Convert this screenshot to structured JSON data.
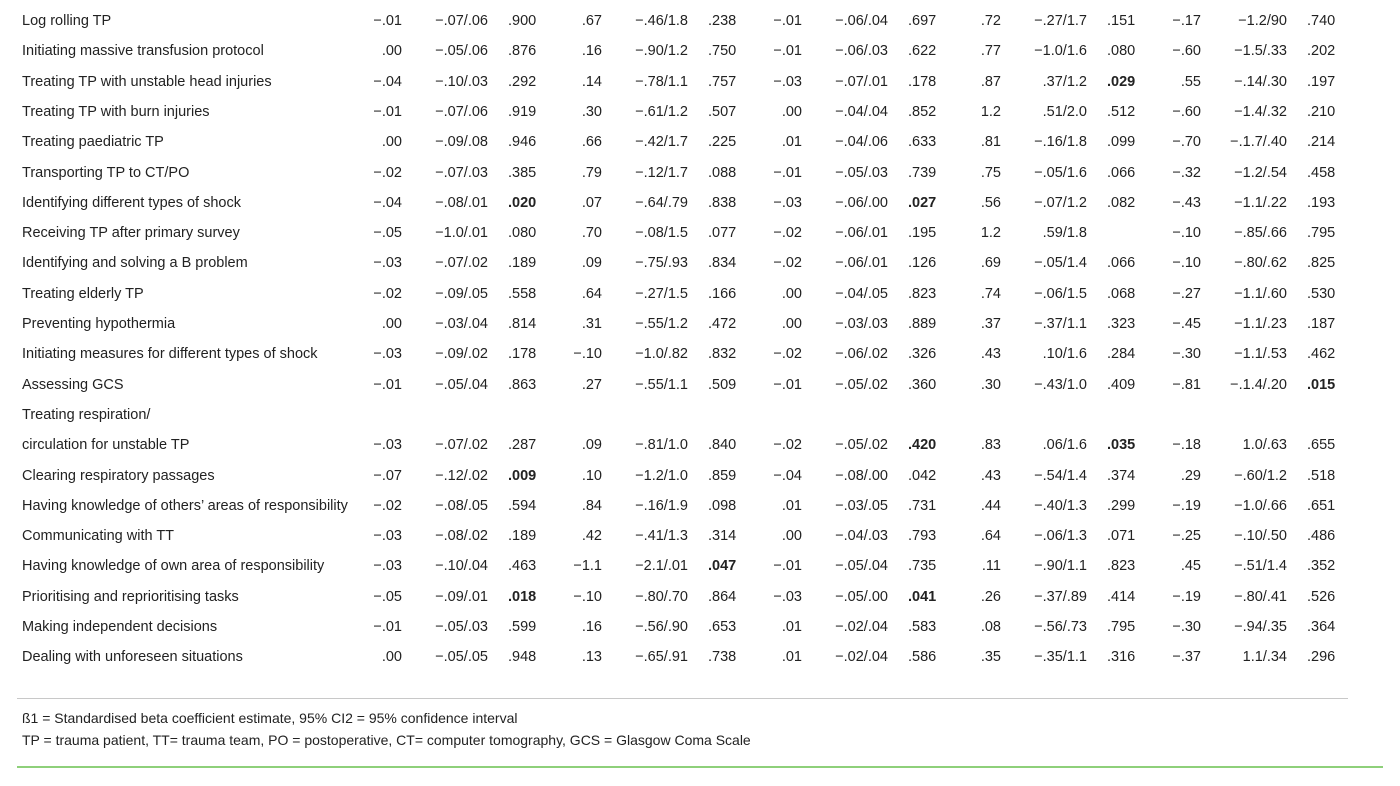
{
  "table": {
    "rows": [
      {
        "label": "Log rolling TP",
        "cells": [
          "−.01",
          "−.07/.06",
          ".900",
          ".67",
          "−.46/1.8",
          ".238",
          "−.01",
          "−.06/.04",
          ".697",
          ".72",
          "−.27/1.7",
          ".151",
          "−.17",
          "−1.2/90",
          ".740"
        ],
        "bold": []
      },
      {
        "label": "Initiating massive transfusion protocol",
        "cells": [
          ".00",
          "−.05/.06",
          ".876",
          ".16",
          "−.90/1.2",
          ".750",
          "−.01",
          "−.06/.03",
          ".622",
          ".77",
          "−1.0/1.6",
          ".080",
          "−.60",
          "−1.5/.33",
          ".202"
        ],
        "bold": []
      },
      {
        "label": "Treating TP with unstable head injuries",
        "cells": [
          "−.04",
          "−.10/.03",
          ".292",
          ".14",
          "−.78/1.1",
          ".757",
          "−.03",
          "−.07/.01",
          ".178",
          ".87",
          ".37/1.2",
          ".029",
          ".55",
          "−.14/.30",
          ".197"
        ],
        "bold": [
          11
        ]
      },
      {
        "label": "Treating TP with burn injuries",
        "cells": [
          "−.01",
          "−.07/.06",
          ".919",
          ".30",
          "−.61/1.2",
          ".507",
          ".00",
          "−.04/.04",
          ".852",
          "1.2",
          ".51/2.0",
          ".512",
          "−.60",
          "−1.4/.32",
          ".210"
        ],
        "bold": []
      },
      {
        "label": "Treating paediatric TP",
        "cells": [
          ".00",
          "−.09/.08",
          ".946",
          ".66",
          "−.42/1.7",
          ".225",
          ".01",
          "−.04/.06",
          ".633",
          ".81",
          "−.16/1.8",
          ".099",
          "−.70",
          "−.1.7/.40",
          ".214"
        ],
        "bold": []
      },
      {
        "label": "Transporting TP to CT/PO",
        "cells": [
          "−.02",
          "−.07/.03",
          ".385",
          ".79",
          "−.12/1.7",
          ".088",
          "−.01",
          "−.05/.03",
          ".739",
          ".75",
          "−.05/1.6",
          ".066",
          "−.32",
          "−1.2/.54",
          ".458"
        ],
        "bold": []
      },
      {
        "label": "Identifying different types of shock",
        "cells": [
          "−.04",
          "−.08/.01",
          ".020",
          ".07",
          "−.64/.79",
          ".838",
          "−.03",
          "−.06/.00",
          ".027",
          ".56",
          "−.07/1.2",
          ".082",
          "−.43",
          "−1.1/.22",
          ".193"
        ],
        "bold": [
          2,
          8
        ]
      },
      {
        "label": "Receiving TP after primary survey",
        "cells": [
          "−.05",
          "−1.0/.01",
          ".080",
          ".70",
          "−.08/1.5",
          ".077",
          "−.02",
          "−.06/.01",
          ".195",
          "1.2",
          ".59/1.8",
          "",
          "−.10",
          "−.85/.66",
          ".795"
        ],
        "bold": []
      },
      {
        "label": "Identifying and solving a B problem",
        "cells": [
          "−.03",
          "−.07/.02",
          ".189",
          ".09",
          "−.75/.93",
          ".834",
          "−.02",
          "−.06/.01",
          ".126",
          ".69",
          "−.05/1.4",
          ".066",
          "−.10",
          "−.80/.62",
          ".825"
        ],
        "bold": []
      },
      {
        "label": "Treating elderly TP",
        "cells": [
          "−.02",
          "−.09/.05",
          ".558",
          ".64",
          "−.27/1.5",
          ".166",
          ".00",
          "−.04/.05",
          ".823",
          ".74",
          "−.06/1.5",
          ".068",
          "−.27",
          "−1.1/.60",
          ".530"
        ],
        "bold": []
      },
      {
        "label": "Preventing hypothermia",
        "cells": [
          ".00",
          "−.03/.04",
          ".814",
          ".31",
          "−.55/1.2",
          ".472",
          ".00",
          "−.03/.03",
          ".889",
          ".37",
          "−.37/1.1",
          ".323",
          "−.45",
          "−1.1/.23",
          ".187"
        ],
        "bold": []
      },
      {
        "label": "Initiating measures for different types of shock",
        "cells": [
          "−.03",
          "−.09/.02",
          ".178",
          "−.10",
          "−1.0/.82",
          ".832",
          "−.02",
          "−.06/.02",
          ".326",
          ".43",
          ".10/1.6",
          ".284",
          "−.30",
          "−1.1/.53",
          ".462"
        ],
        "bold": []
      },
      {
        "label": "Assessing GCS",
        "cells": [
          "−.01",
          "−.05/.04",
          ".863",
          ".27",
          "−.55/1.1",
          ".509",
          "−.01",
          "−.05/.02",
          ".360",
          ".30",
          "−.43/1.0",
          ".409",
          "−.81",
          "−.1.4/.20",
          ".015"
        ],
        "bold": [
          14
        ]
      },
      {
        "label": "Treating respiration/",
        "cells": [],
        "bold": []
      },
      {
        "label": "circulation for unstable TP",
        "cells": [
          "−.03",
          "−.07/.02",
          ".287",
          ".09",
          "−.81/1.0",
          ".840",
          "−.02",
          "−.05/.02",
          ".420",
          ".83",
          ".06/1.6",
          ".035",
          "−.18",
          "1.0/.63",
          ".655"
        ],
        "bold": [
          8,
          11
        ]
      },
      {
        "label": "Clearing respiratory passages",
        "cells": [
          "−.07",
          "−.12/.02",
          ".009",
          ".10",
          "−1.2/1.0",
          ".859",
          "−.04",
          "−.08/.00",
          ".042",
          ".43",
          "−.54/1.4",
          ".374",
          ".29",
          "−.60/1.2",
          ".518"
        ],
        "bold": [
          2
        ]
      },
      {
        "label": "Having knowledge of others’ areas of responsibility",
        "cells": [
          "−.02",
          "−.08/.05",
          ".594",
          ".84",
          "−.16/1.9",
          ".098",
          ".01",
          "−.03/.05",
          ".731",
          ".44",
          "−.40/1.3",
          ".299",
          "−.19",
          "−1.0/.66",
          ".651"
        ],
        "bold": []
      },
      {
        "label": "Communicating with TT",
        "cells": [
          "−.03",
          "−.08/.02",
          ".189",
          ".42",
          "−.41/1.3",
          ".314",
          ".00",
          "−.04/.03",
          ".793",
          ".64",
          "−.06/1.3",
          ".071",
          "−.25",
          "−.10/.50",
          ".486"
        ],
        "bold": []
      },
      {
        "label": "Having knowledge of own area of responsibility",
        "cells": [
          "−.03",
          "−.10/.04",
          ".463",
          "−1.1",
          "−2.1/.01",
          ".047",
          "−.01",
          "−.05/.04",
          ".735",
          ".11",
          "−.90/1.1",
          ".823",
          ".45",
          "−.51/1.4",
          ".352"
        ],
        "bold": [
          5
        ]
      },
      {
        "label": "Prioritising and reprioritising tasks",
        "cells": [
          "−.05",
          "−.09/.01",
          ".018",
          "−.10",
          "−.80/.70",
          ".864",
          "−.03",
          "−.05/.00",
          ".041",
          ".26",
          "−.37/.89",
          ".414",
          "−.19",
          "−.80/.41",
          ".526"
        ],
        "bold": [
          2,
          8
        ]
      },
      {
        "label": "Making independent decisions",
        "cells": [
          "−.01",
          "−.05/.03",
          ".599",
          ".16",
          "−.56/.90",
          ".653",
          ".01",
          "−.02/.04",
          ".583",
          ".08",
          "−.56/.73",
          ".795",
          "−.30",
          "−.94/.35",
          ".364"
        ],
        "bold": []
      },
      {
        "label": "Dealing with unforeseen situations",
        "cells": [
          ".00",
          "−.05/.05",
          ".948",
          ".13",
          "−.65/.91",
          ".738",
          ".01",
          "−.02/.04",
          ".586",
          ".35",
          "−.35/1.1",
          ".316",
          "−.37",
          "1.1/.34",
          ".296"
        ],
        "bold": []
      }
    ]
  },
  "footnotes": [
    "ß1 = Standardised beta coefficient estimate, 95% CI2 = 95% confidence interval",
    "TP = trauma patient, TT= trauma team, PO = postoperative, CT= computer tomography, GCS = Glasgow Coma Scale"
  ],
  "colors": {
    "rule_gray": "#c8c8c8",
    "rule_green": "#8ed07a",
    "text": "#222222"
  }
}
